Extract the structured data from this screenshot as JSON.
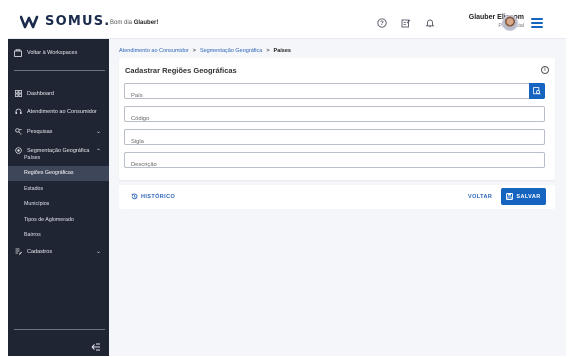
{
  "brand": {
    "logo_text": "SOMUS."
  },
  "header": {
    "greeting_prefix": "Bom dia ",
    "greeting_name": "Glauber!",
    "icons": [
      "help-icon",
      "notes-icon",
      "bell-icon"
    ],
    "user_name": "Glauber Elissom",
    "user_role": "Presencial"
  },
  "sidebar": {
    "workspaces_label": "Voltar à Workspaces",
    "items": [
      {
        "label": "Dashboard",
        "icon": "dashboard-icon"
      },
      {
        "label": "Atendimento ao Consumidor",
        "icon": "headset-icon"
      },
      {
        "label": "Pesquisas",
        "icon": "search-list-icon",
        "chevron": "⌄"
      },
      {
        "label": "Segmentação Geográfica",
        "icon": "location-icon",
        "chevron": "⌃"
      }
    ],
    "subitems": [
      "Países",
      "Regiões Geográficas",
      "Estados",
      "Municípios",
      "Tipos de Aglomerado",
      "Bairros"
    ],
    "active_subitem": "Regiões Geográficas",
    "cadastros": {
      "label": "Cadastros",
      "icon": "form-icon",
      "chevron": "⌄"
    }
  },
  "breadcrumb": {
    "level1": "Atendimento ao Consumidor",
    "level2": "Segmentação Geográfica",
    "current": "Países",
    "separator": ">"
  },
  "form": {
    "title": "Cadastrar Regiões Geográficas",
    "fields": {
      "pais": {
        "placeholder": "País",
        "value": ""
      },
      "codigo": {
        "placeholder": "Código",
        "value": ""
      },
      "sigla": {
        "placeholder": "Sigla",
        "value": ""
      },
      "descricao": {
        "placeholder": "Descrição",
        "value": ""
      }
    }
  },
  "actions": {
    "history_label": "HISTÓRICO",
    "back_label": "VOLTAR",
    "save_label": "SALVAR"
  },
  "colors": {
    "primary": "#1565c0",
    "sidebar": "#1f2533",
    "link": "#2d64b8"
  }
}
